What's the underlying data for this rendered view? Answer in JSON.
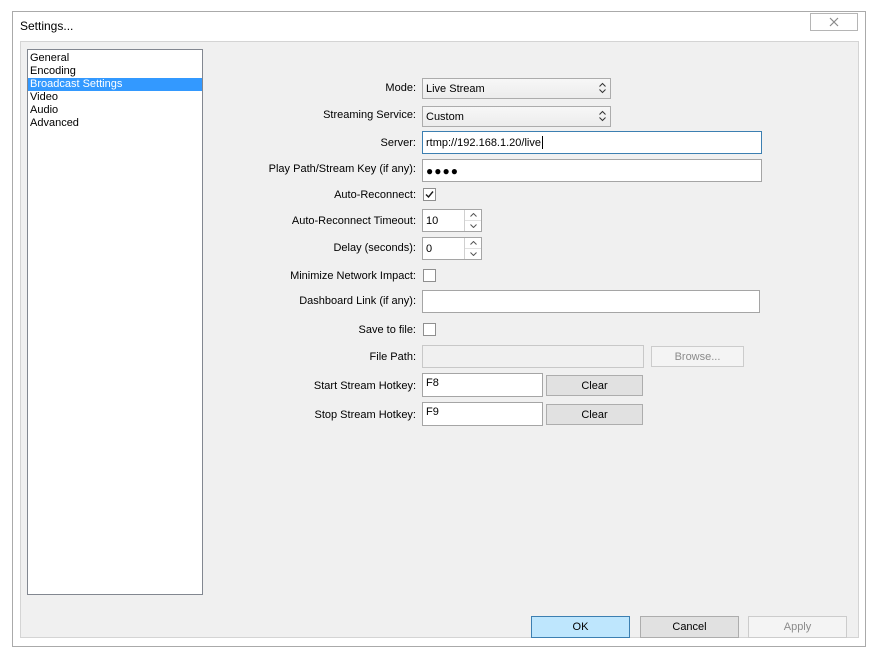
{
  "window": {
    "title": "Settings..."
  },
  "icons": {
    "close": "close-icon",
    "combo_arrow": "updown-arrow-icon",
    "check": "checkmark-icon"
  },
  "colors": {
    "selection": "#3399ff",
    "ok_button": "#bee6fd"
  },
  "categories": {
    "items": [
      {
        "label": "General"
      },
      {
        "label": "Encoding"
      },
      {
        "label": "Broadcast Settings"
      },
      {
        "label": "Video"
      },
      {
        "label": "Audio"
      },
      {
        "label": "Advanced"
      }
    ],
    "selected": "Broadcast Settings"
  },
  "form": {
    "mode": {
      "label": "Mode:",
      "value": "Live Stream"
    },
    "service": {
      "label": "Streaming Service:",
      "value": "Custom"
    },
    "server": {
      "label": "Server:",
      "value": "rtmp://192.168.1.20/live"
    },
    "stream_key": {
      "label": "Play Path/Stream Key (if any):",
      "value": "●●●●"
    },
    "auto_reconnect": {
      "label": "Auto-Reconnect:",
      "checked": true
    },
    "reconnect_timeout": {
      "label": "Auto-Reconnect Timeout:",
      "value": "10"
    },
    "delay": {
      "label": "Delay (seconds):",
      "value": "0"
    },
    "minimize_impact": {
      "label": "Minimize Network Impact:",
      "checked": false
    },
    "dashboard_link": {
      "label": "Dashboard Link (if any):",
      "value": ""
    },
    "save_to_file": {
      "label": "Save to file:",
      "checked": false
    },
    "file_path": {
      "label": "File Path:",
      "value": "",
      "browse_label": "Browse..."
    },
    "start_hotkey": {
      "label": "Start Stream Hotkey:",
      "value": "F8",
      "clear_label": "Clear"
    },
    "stop_hotkey": {
      "label": "Stop Stream Hotkey:",
      "value": "F9",
      "clear_label": "Clear"
    }
  },
  "footer": {
    "ok_label": "OK",
    "cancel_label": "Cancel",
    "apply_label": "Apply"
  }
}
